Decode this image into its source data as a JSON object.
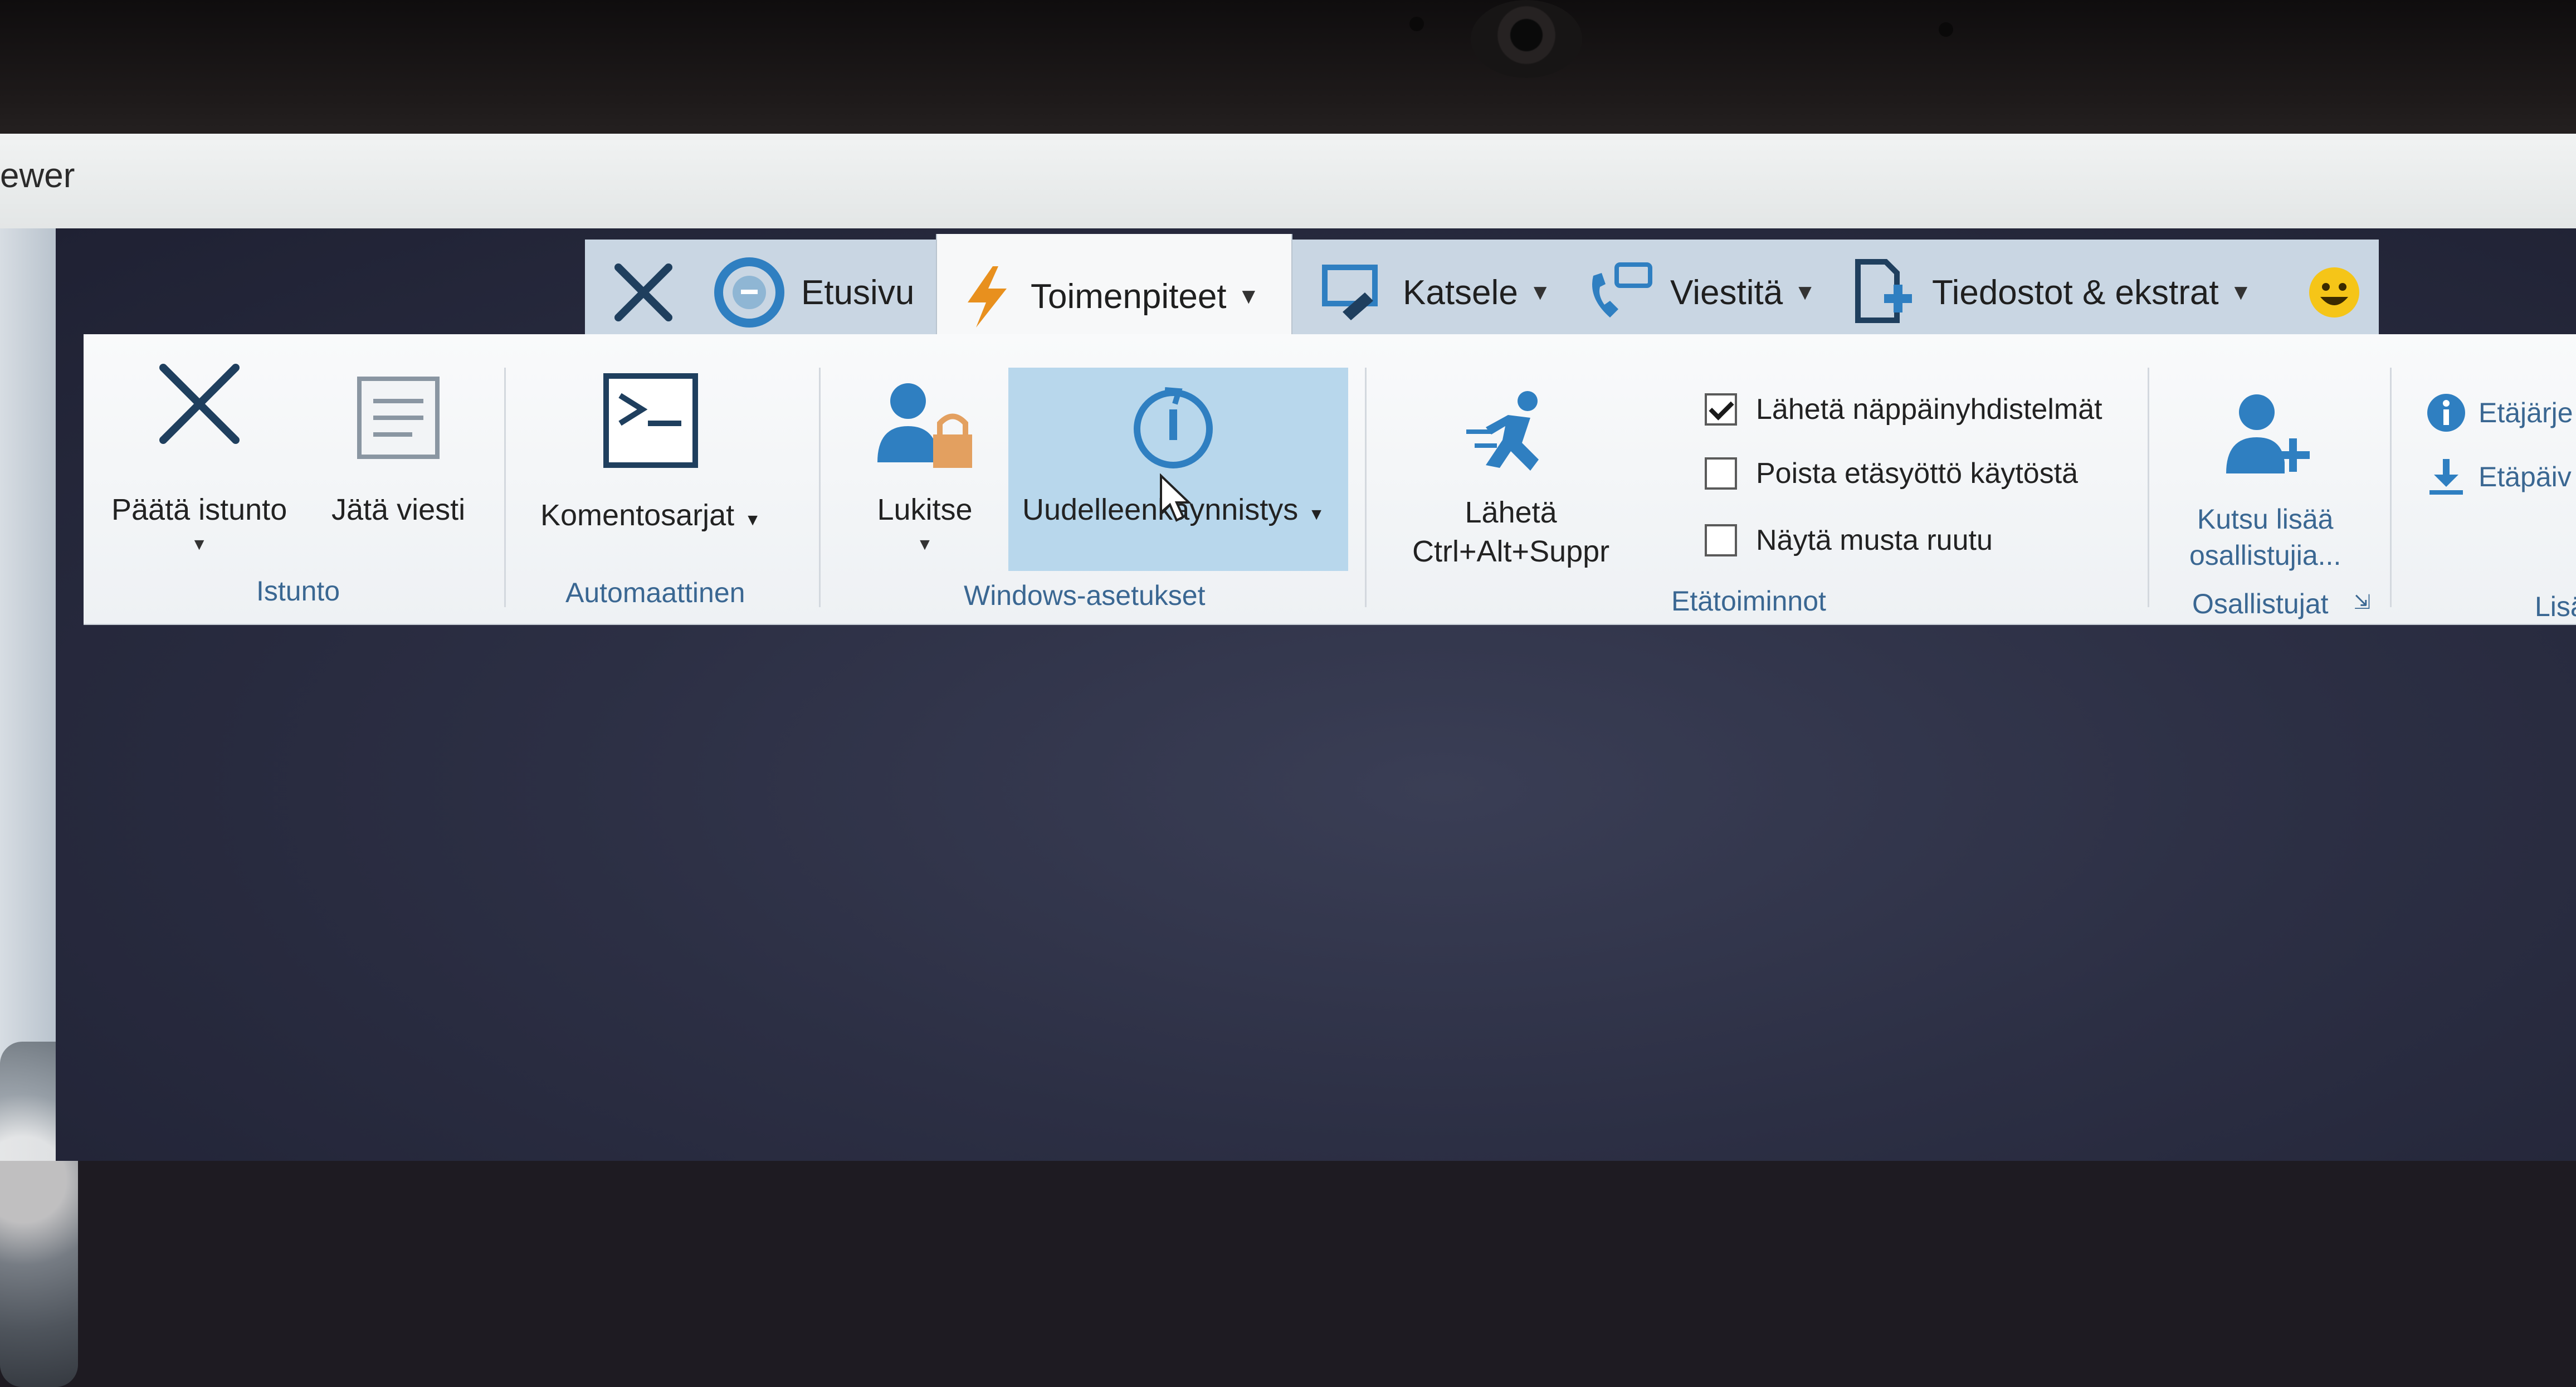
{
  "window": {
    "title_fragment": "ewer"
  },
  "tabs": [
    {
      "label": "",
      "icon": "close-x-icon"
    },
    {
      "label": "Etusivu",
      "icon": "home-circle-icon"
    },
    {
      "label": "Toimenpiteet",
      "icon": "lightning-icon",
      "active": true,
      "has_dropdown": true
    },
    {
      "label": "Katsele",
      "icon": "monitor-view-icon",
      "has_dropdown": true
    },
    {
      "label": "Viestitä",
      "icon": "phone-chat-icon",
      "has_dropdown": true
    },
    {
      "label": "Tiedostot & ekstrat",
      "icon": "file-plus-icon",
      "has_dropdown": true
    },
    {
      "label": "",
      "icon": "smiley-icon"
    }
  ],
  "ribbon": {
    "istunto": {
      "label": "Istunto",
      "end_session": "Päätä istunto",
      "leave_message": "Jätä viesti"
    },
    "automaattinen": {
      "label": "Automaattinen",
      "scripts": "Komentosarjat"
    },
    "windows": {
      "label": "Windows-asetukset",
      "lock": "Lukitse",
      "restart": "Uudelleenkäynnistys"
    },
    "etatoiminnot": {
      "label": "Etätoiminnot",
      "send_line1": "Lähetä",
      "send_line2": "Ctrl+Alt+Suppr",
      "check_send_keys": {
        "label": "Lähetä näppäinyhdistelmät",
        "checked": true
      },
      "check_disable_input": {
        "label": "Poista etäsyöttö käytöstä",
        "checked": false
      },
      "check_black_screen": {
        "label": "Näytä musta ruutu",
        "checked": false
      }
    },
    "osallistujat": {
      "label": "Osallistujat",
      "invite_line1": "Kutsu lisää",
      "invite_line2": "osallistujia..."
    },
    "right_partial": {
      "item1": "Etäjärje",
      "item2": "Etäpäiv",
      "group": "Lisä"
    }
  },
  "colors": {
    "accent": "#2f7fc1",
    "ribbon_bg": "#f4f6f8",
    "tabbar_bg": "#c9d6e3",
    "highlight": "#b8d7ec",
    "group_label": "#3a6792"
  }
}
